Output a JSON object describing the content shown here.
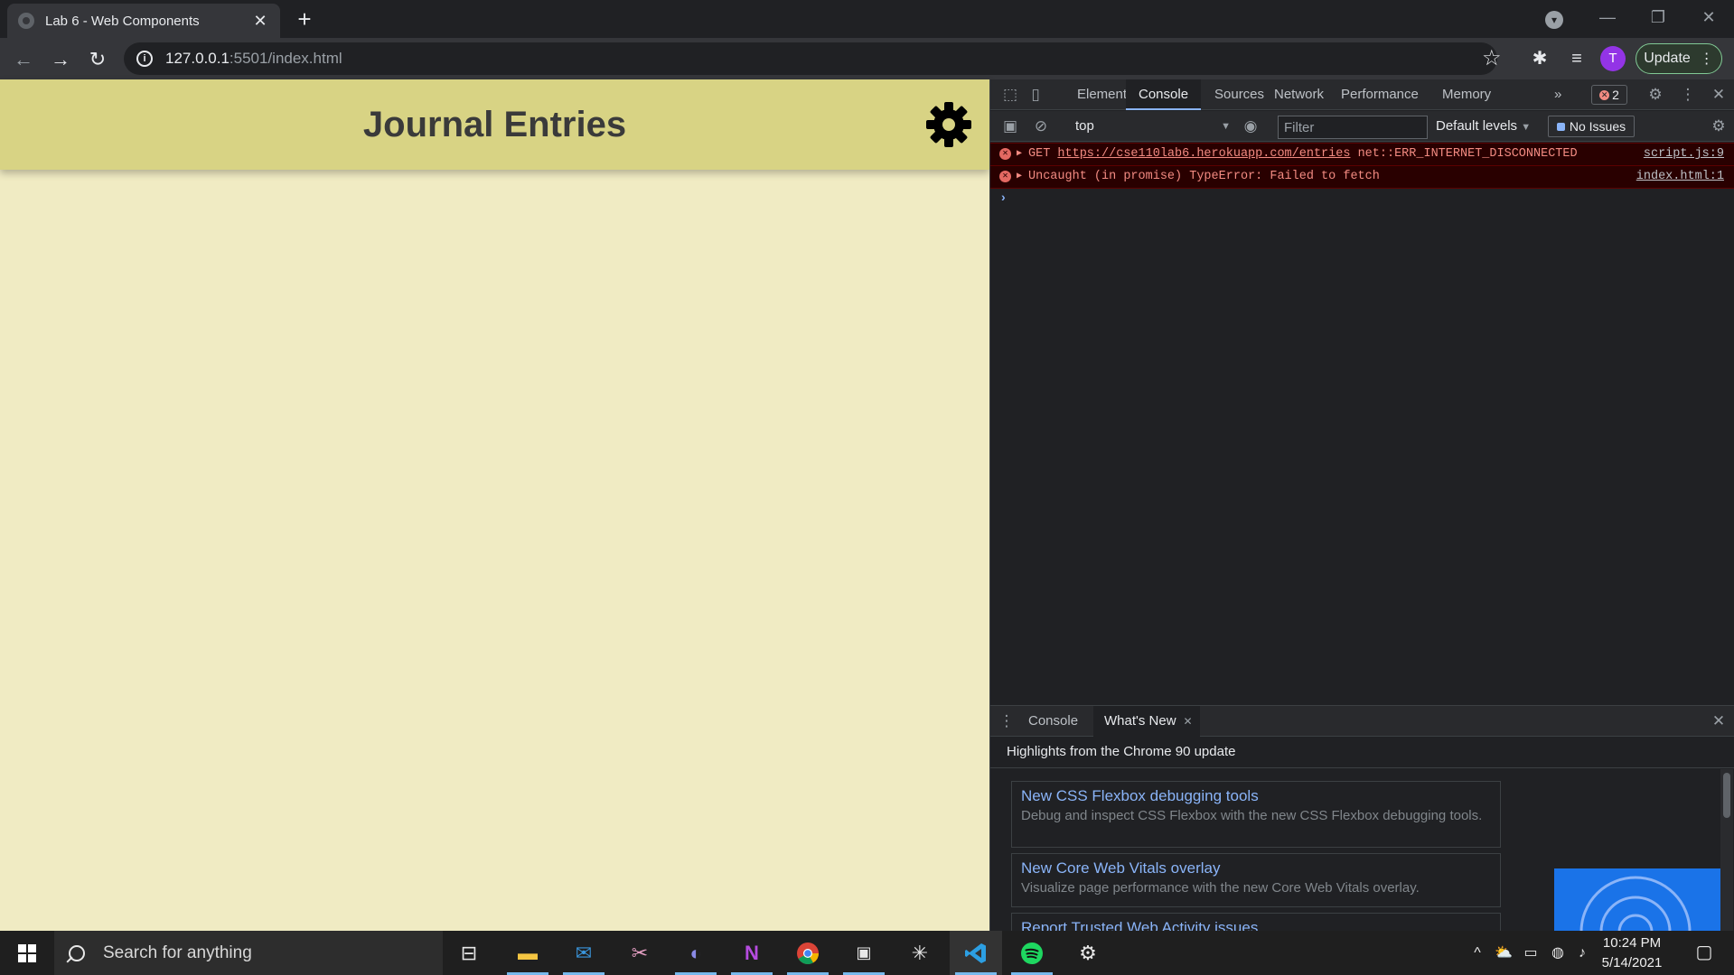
{
  "browser": {
    "tab_title": "Lab 6 - Web Components",
    "tab_close": "✕",
    "new_tab": "+",
    "url_host": "127.0.0.1",
    "url_path": ":5501/index.html",
    "update_label": "Update",
    "avatar_initial": "T"
  },
  "page": {
    "title": "Journal Entries",
    "header_color": "#d8d384",
    "background_color": "#f0ebc3"
  },
  "devtools": {
    "tabs": [
      "Elements",
      "Console",
      "Sources",
      "Network",
      "Performance",
      "Memory"
    ],
    "active_tab": "Console",
    "more_tabs": "»",
    "error_count": "2",
    "context": "top",
    "filter_placeholder": "Filter",
    "levels_label": "Default levels",
    "issues_label": "No Issues",
    "messages": [
      {
        "prefix": "GET ",
        "url": "https://cse110lab6.herokuapp.com/entries",
        "suffix": " net::ERR_INTERNET_DISCONNECTED",
        "source": "script.js:9"
      },
      {
        "prefix": "Uncaught (in promise) TypeError: Failed to fetch",
        "url": "",
        "suffix": "",
        "source": "index.html:1"
      }
    ],
    "drawer": {
      "tabs": [
        "Console",
        "What's New"
      ],
      "active_tab": "What's New",
      "heading": "Highlights from the Chrome 90 update",
      "cards": [
        {
          "title": "New CSS Flexbox debugging tools",
          "desc": "Debug and inspect CSS Flexbox with the new CSS Flexbox debugging tools."
        },
        {
          "title": "New Core Web Vitals overlay",
          "desc": "Visualize page performance with the new Core Web Vitals overlay."
        },
        {
          "title": "Report Trusted Web Activity issues",
          "desc": ""
        }
      ]
    }
  },
  "taskbar": {
    "search_placeholder": "Search for anything",
    "time": "10:24 PM",
    "date": "5/14/2021"
  }
}
